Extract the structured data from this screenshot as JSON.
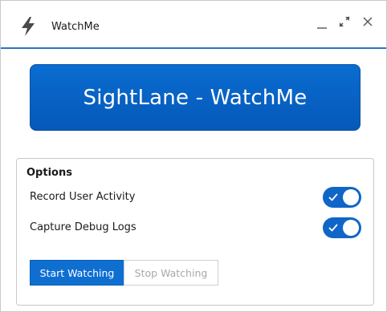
{
  "window": {
    "title": "WatchMe",
    "icons": {
      "app": "lightning-bolt-icon",
      "minimize": "minimize-icon",
      "maximize": "expand-arrows-icon",
      "close": "close-icon"
    }
  },
  "banner": {
    "title": "SightLane - WatchMe"
  },
  "options": {
    "title": "Options",
    "items": [
      {
        "label": "Record User Activity",
        "enabled": true
      },
      {
        "label": "Capture Debug Logs",
        "enabled": true
      }
    ]
  },
  "actions": {
    "start_label": "Start Watching",
    "stop_label": "Stop Watching",
    "stop_enabled": false
  },
  "colors": {
    "accent": "#0f66c8",
    "banner": "#0662c4",
    "titlebar_rule": "#2b74c6",
    "disabled_text": "#a8a8a8"
  }
}
